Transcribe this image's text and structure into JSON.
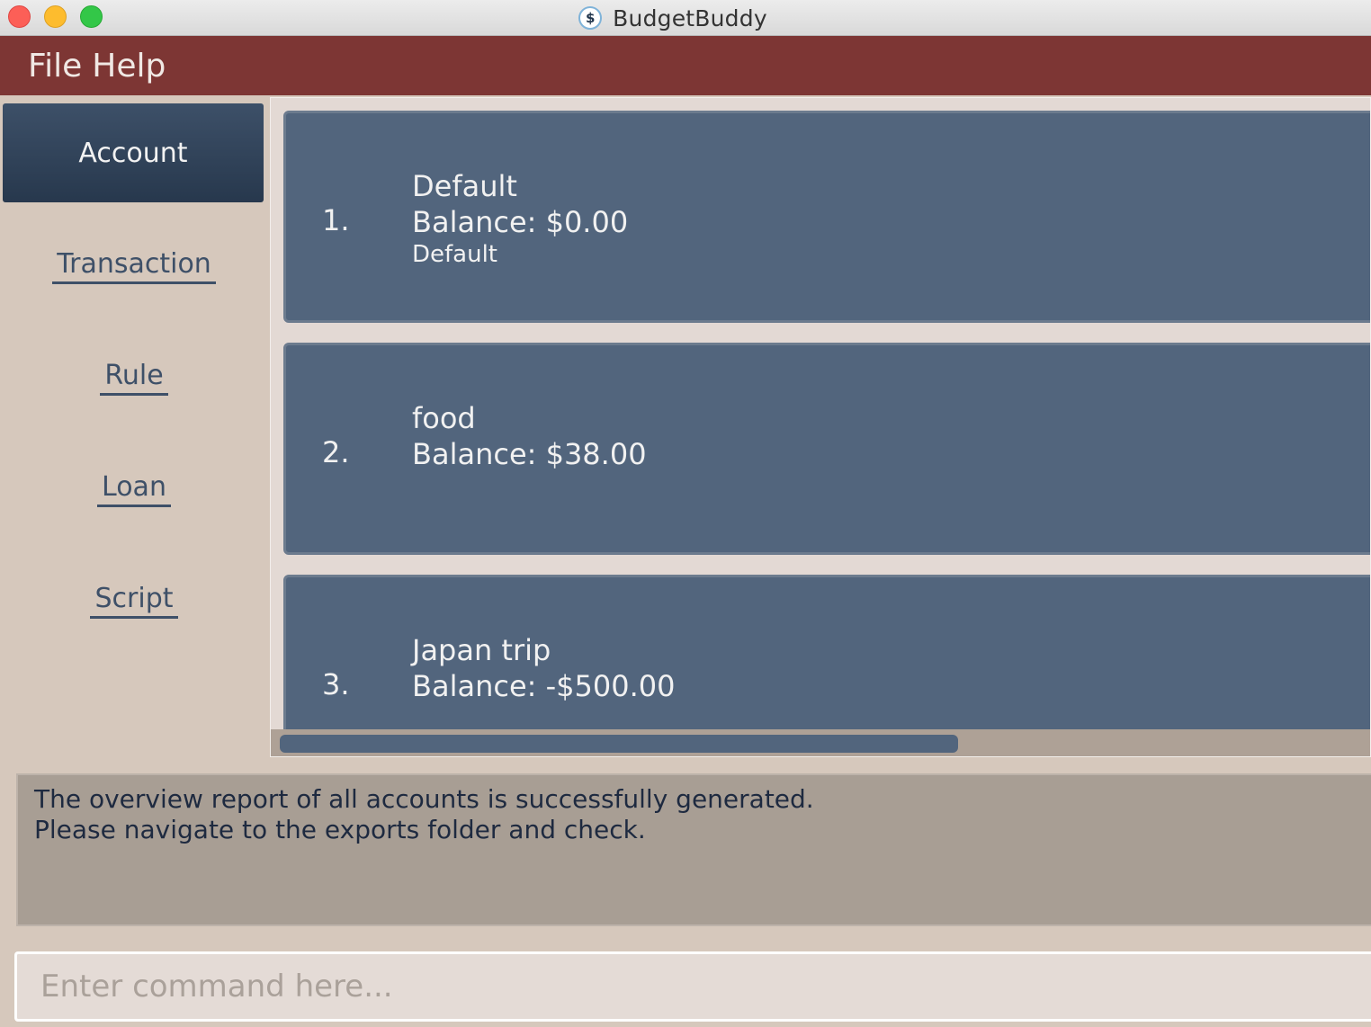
{
  "window": {
    "title": "BudgetBuddy",
    "icon": "dollar-icon",
    "icon_glyph": "$"
  },
  "menu": {
    "items": [
      "File",
      "Help"
    ]
  },
  "sidebar": {
    "active": "Account",
    "links": [
      "Transaction",
      "Rule",
      "Loan",
      "Script"
    ]
  },
  "accounts": [
    {
      "index": "1.",
      "name": "Default",
      "balance": "Balance: $0.00",
      "tag": "Default"
    },
    {
      "index": "2.",
      "name": "food",
      "balance": "Balance: $38.00"
    },
    {
      "index": "3.",
      "name": "Japan trip",
      "balance": "Balance: -$500.00"
    }
  ],
  "result": {
    "lines": [
      "The overview report of all accounts is successfully generated.",
      "Please navigate to the exports folder and check."
    ]
  },
  "command": {
    "placeholder": "Enter command here...",
    "value": ""
  },
  "colors": {
    "menubar": "#7d3634",
    "card": "#52657d",
    "sidebar": "#d6c8bc",
    "result": "#a89e94"
  }
}
